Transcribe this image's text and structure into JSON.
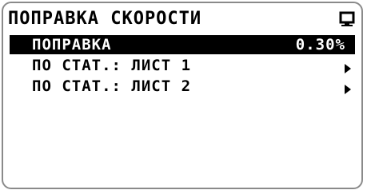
{
  "screen": {
    "title": "ПОПРАВКА СКОРОСТИ",
    "title_icon": "monitor-icon"
  },
  "menu": {
    "items": [
      {
        "label": "ПОПРАВКА",
        "value": "0.30%",
        "selected": true,
        "icon": null
      },
      {
        "label": "ПО СТАТ.: ЛИСТ 1",
        "value": "",
        "selected": false,
        "icon": "arrow-right-icon"
      },
      {
        "label": "ПО СТАТ.: ЛИСТ 2",
        "value": "",
        "selected": false,
        "icon": "arrow-right-icon"
      }
    ]
  },
  "colors": {
    "background": "#ffffff",
    "text": "#000000",
    "selection": "#000000",
    "selection_text": "#ffffff",
    "border": "#8a8a8a"
  }
}
